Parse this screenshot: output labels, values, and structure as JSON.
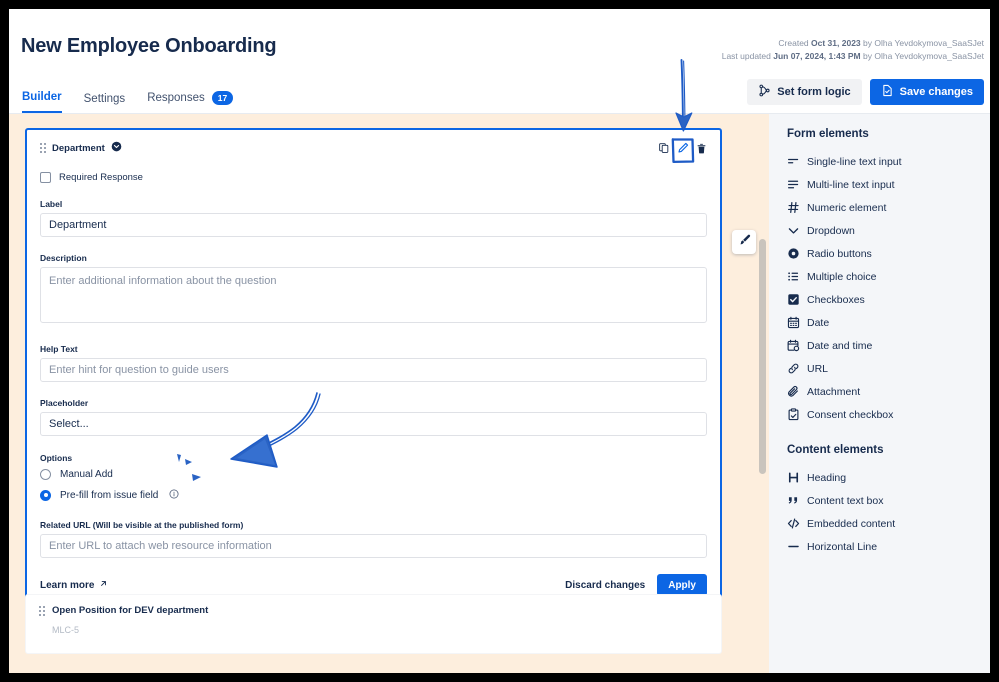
{
  "header": {
    "title": "New Employee Onboarding",
    "created_prefix": "Created ",
    "created_date": "Oct 31, 2023",
    "created_by": " by Olha Yevdokymova_SaaSJet",
    "updated_prefix": "Last updated ",
    "updated_date": "Jun 07, 2024, 1:43 PM",
    "updated_by": " by Olha Yevdokymova_SaaSJet",
    "tabs": [
      {
        "label": "Builder",
        "active": true,
        "badge": null
      },
      {
        "label": "Settings",
        "active": false,
        "badge": null
      },
      {
        "label": "Responses",
        "active": false,
        "badge": "17"
      }
    ],
    "buttons": {
      "set_form_logic": "Set form logic",
      "save_changes": "Save changes"
    }
  },
  "canvas": {
    "brush_tooltip": "Theme",
    "question_card": {
      "title": "Department",
      "required_label": "Required Response",
      "fields": {
        "label_title": "Label",
        "label_value": "Department",
        "description_title": "Description",
        "description_placeholder": "Enter additional information about the question",
        "description_value": "",
        "help_title": "Help Text",
        "help_placeholder": "Enter hint for question to guide users",
        "help_value": "",
        "placeholder_title": "Placeholder",
        "placeholder_value": "Select...",
        "related_url_title": "Related URL (Will be visible at the published form)",
        "related_url_placeholder": "Enter URL to attach web resource information",
        "related_url_value": ""
      },
      "options": {
        "title": "Options",
        "items": [
          {
            "label": "Manual Add",
            "selected": false,
            "info": false
          },
          {
            "label": "Pre-fill from issue field",
            "selected": true,
            "info": true
          }
        ]
      },
      "footer": {
        "learn_more": "Learn more",
        "discard": "Discard changes",
        "apply": "Apply"
      }
    },
    "next_card": {
      "title": "Open Position for DEV department",
      "key": "MLC-5"
    }
  },
  "sidebar": {
    "form_elements_title": "Form elements",
    "form_elements": [
      {
        "label": "Single-line text input",
        "icon": "single-line-text-icon"
      },
      {
        "label": "Multi-line text input",
        "icon": "multi-line-text-icon"
      },
      {
        "label": "Numeric element",
        "icon": "hash-icon"
      },
      {
        "label": "Dropdown",
        "icon": "chevron-down-icon"
      },
      {
        "label": "Radio buttons",
        "icon": "radio-icon"
      },
      {
        "label": "Multiple choice",
        "icon": "list-icon"
      },
      {
        "label": "Checkboxes",
        "icon": "checkbox-icon"
      },
      {
        "label": "Date",
        "icon": "calendar-icon"
      },
      {
        "label": "Date and time",
        "icon": "calendar-clock-icon"
      },
      {
        "label": "URL",
        "icon": "link-icon"
      },
      {
        "label": "Attachment",
        "icon": "paperclip-icon"
      },
      {
        "label": "Consent checkbox",
        "icon": "clipboard-check-icon"
      }
    ],
    "content_elements_title": "Content elements",
    "content_elements": [
      {
        "label": "Heading",
        "icon": "heading-icon"
      },
      {
        "label": "Content text box",
        "icon": "quote-icon"
      },
      {
        "label": "Embedded content",
        "icon": "code-icon"
      },
      {
        "label": "Horizontal Line",
        "icon": "horizontal-line-icon"
      }
    ]
  },
  "colors": {
    "accent": "#0c66e4",
    "canvas_bg": "#fdeedd",
    "sidebar_bg": "#f4f6f9",
    "text": "#172b4d",
    "annotation": "#1e5bc6"
  }
}
